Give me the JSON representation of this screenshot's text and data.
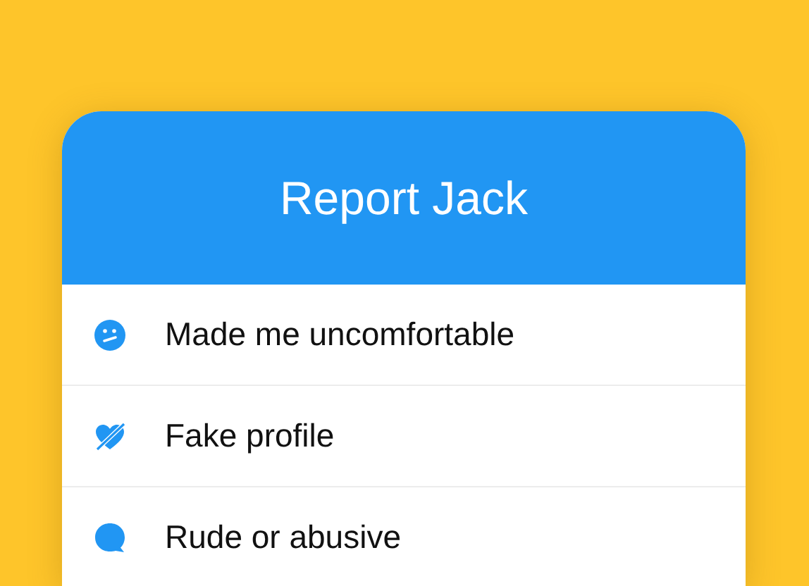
{
  "dialog": {
    "title": "Report Jack"
  },
  "options": [
    {
      "kind": "confused",
      "label": "Made me uncomfortable"
    },
    {
      "kind": "broken-heart",
      "label": "Fake profile"
    },
    {
      "kind": "speech",
      "label": "Rude or abusive"
    }
  ]
}
